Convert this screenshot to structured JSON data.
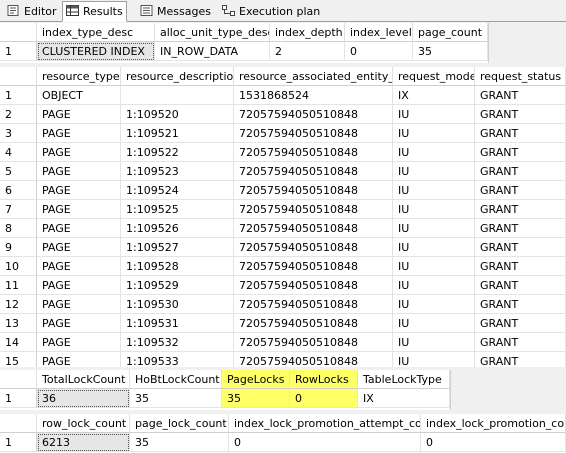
{
  "tabs": [
    {
      "label": "Editor",
      "icon": "editor-icon"
    },
    {
      "label": "Results",
      "icon": "results-grid-icon"
    },
    {
      "label": "Messages",
      "icon": "messages-icon"
    },
    {
      "label": "Execution plan",
      "icon": "execution-plan-icon"
    }
  ],
  "grid1": {
    "columns": [
      "index_type_desc",
      "alloc_unit_type_desc",
      "index_depth",
      "index_level",
      "page_count"
    ],
    "rows": [
      {
        "n": "1",
        "cells": [
          "CLUSTERED INDEX",
          "IN_ROW_DATA",
          "2",
          "0",
          "35"
        ]
      }
    ]
  },
  "grid2": {
    "columns": [
      "resource_type",
      "resource_description",
      "resource_associated_entity_id",
      "request_mode",
      "request_status"
    ],
    "rows": [
      {
        "n": "1",
        "cells": [
          "OBJECT",
          "",
          "1531868524",
          "IX",
          "GRANT"
        ]
      },
      {
        "n": "2",
        "cells": [
          "PAGE",
          "1:109520",
          "72057594050510848",
          "IU",
          "GRANT"
        ]
      },
      {
        "n": "3",
        "cells": [
          "PAGE",
          "1:109521",
          "72057594050510848",
          "IU",
          "GRANT"
        ]
      },
      {
        "n": "4",
        "cells": [
          "PAGE",
          "1:109522",
          "72057594050510848",
          "IU",
          "GRANT"
        ]
      },
      {
        "n": "5",
        "cells": [
          "PAGE",
          "1:109523",
          "72057594050510848",
          "IU",
          "GRANT"
        ]
      },
      {
        "n": "6",
        "cells": [
          "PAGE",
          "1:109524",
          "72057594050510848",
          "IU",
          "GRANT"
        ]
      },
      {
        "n": "7",
        "cells": [
          "PAGE",
          "1:109525",
          "72057594050510848",
          "IU",
          "GRANT"
        ]
      },
      {
        "n": "8",
        "cells": [
          "PAGE",
          "1:109526",
          "72057594050510848",
          "IU",
          "GRANT"
        ]
      },
      {
        "n": "9",
        "cells": [
          "PAGE",
          "1:109527",
          "72057594050510848",
          "IU",
          "GRANT"
        ]
      },
      {
        "n": "10",
        "cells": [
          "PAGE",
          "1:109528",
          "72057594050510848",
          "IU",
          "GRANT"
        ]
      },
      {
        "n": "11",
        "cells": [
          "PAGE",
          "1:109529",
          "72057594050510848",
          "IU",
          "GRANT"
        ]
      },
      {
        "n": "12",
        "cells": [
          "PAGE",
          "1:109530",
          "72057594050510848",
          "IU",
          "GRANT"
        ]
      },
      {
        "n": "13",
        "cells": [
          "PAGE",
          "1:109531",
          "72057594050510848",
          "IU",
          "GRANT"
        ]
      },
      {
        "n": "14",
        "cells": [
          "PAGE",
          "1:109532",
          "72057594050510848",
          "IU",
          "GRANT"
        ]
      },
      {
        "n": "15",
        "cells": [
          "PAGE",
          "1:109533",
          "72057594050510848",
          "IU",
          "GRANT"
        ]
      }
    ]
  },
  "grid3": {
    "columns": [
      "TotalLockCount",
      "HoBtLockCount",
      "PageLocks",
      "RowLocks",
      "TableLockType"
    ],
    "highlighted_columns": [
      "PageLocks",
      "RowLocks"
    ],
    "rows": [
      {
        "n": "1",
        "cells": [
          "36",
          "35",
          "35",
          "0",
          "IX"
        ]
      }
    ]
  },
  "grid4": {
    "columns": [
      "row_lock_count",
      "page_lock_count",
      "index_lock_promotion_attempt_count",
      "index_lock_promotion_count"
    ],
    "rows": [
      {
        "n": "1",
        "cells": [
          "6213",
          "35",
          "0",
          "0"
        ]
      }
    ]
  },
  "colors": {
    "highlight": "#ffff66",
    "selected_cell": "#e6e6e6",
    "grid_line": "#e4e4e4"
  }
}
